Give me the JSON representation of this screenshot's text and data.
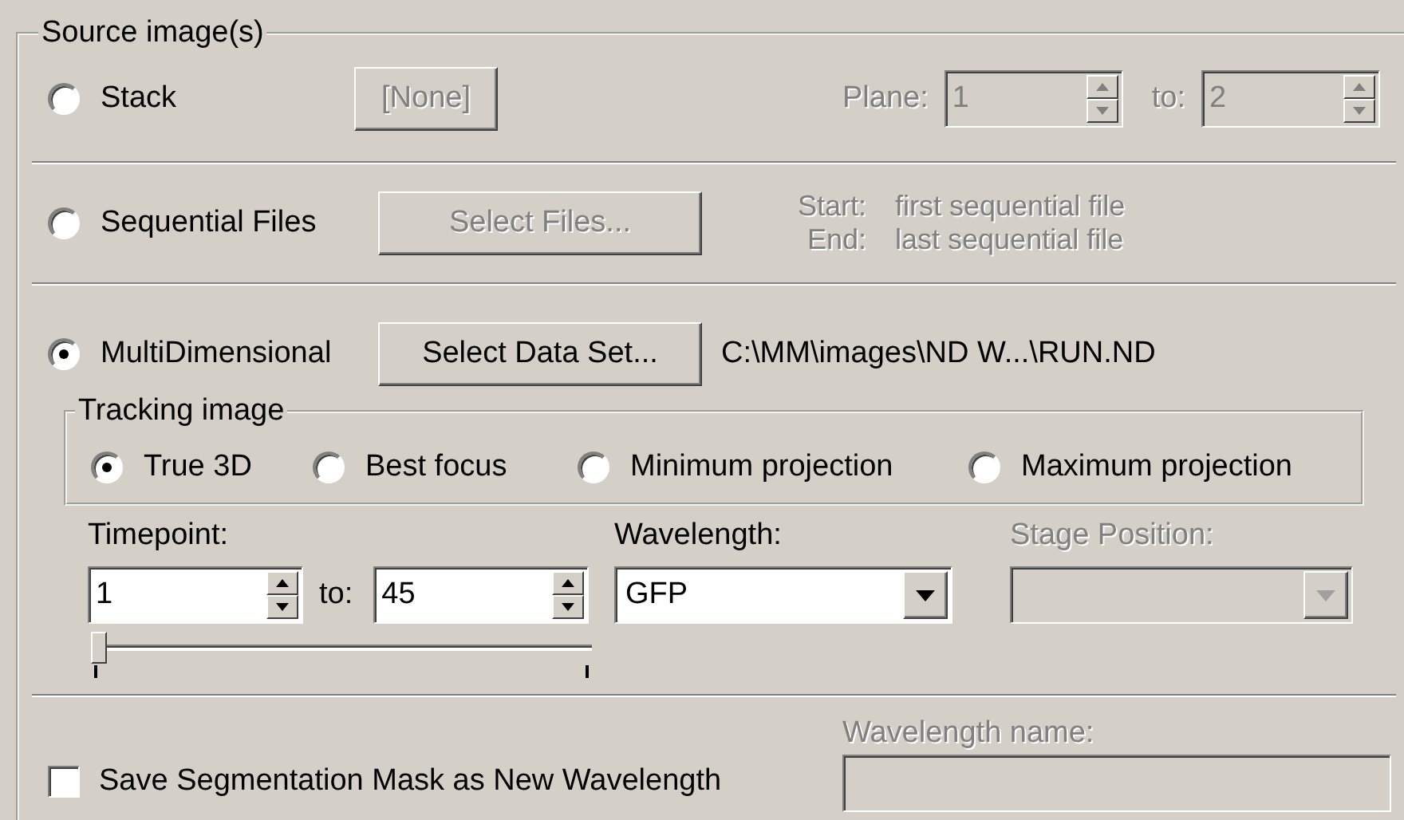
{
  "group": {
    "title": "Source image(s)"
  },
  "sources": [
    {
      "kind": "stack",
      "label": "Stack",
      "selected": false,
      "button": {
        "label": "[None]",
        "disabled": true
      },
      "plane": {
        "label": "Plane:",
        "from": "1",
        "to_label": "to:",
        "to": "2",
        "disabled": true
      }
    },
    {
      "kind": "sequential",
      "label": "Sequential Files",
      "selected": false,
      "button": {
        "label": "Select Files...",
        "disabled": true
      },
      "info": [
        {
          "label": "Start:",
          "value": "first sequential file"
        },
        {
          "label": "End:",
          "value": "last sequential file"
        }
      ],
      "info_disabled": true
    },
    {
      "kind": "multidimensional",
      "label": "MultiDimensional",
      "selected": true,
      "button": {
        "label": "Select Data Set...",
        "disabled": false
      },
      "path": "C:\\MM\\images\\ND W...\\RUN.ND"
    }
  ],
  "tracking": {
    "title": "Tracking image",
    "options": [
      {
        "label": "True 3D",
        "selected": true
      },
      {
        "label": "Best focus",
        "selected": false
      },
      {
        "label": "Minimum projection",
        "selected": false
      },
      {
        "label": "Maximum projection",
        "selected": false
      }
    ]
  },
  "timepoint": {
    "label": "Timepoint:",
    "from": "1",
    "to_label": "to:",
    "to": "45",
    "slider": {
      "level": 0
    }
  },
  "wavelength": {
    "label": "Wavelength:",
    "value": "GFP",
    "disabled": false
  },
  "stage_position": {
    "label": "Stage Position:",
    "disabled": true
  },
  "save_mask": {
    "label": "Save Segmentation Mask as New Wavelength",
    "checked": false
  },
  "wavelength_name": {
    "label": "Wavelength name:",
    "disabled": true
  }
}
